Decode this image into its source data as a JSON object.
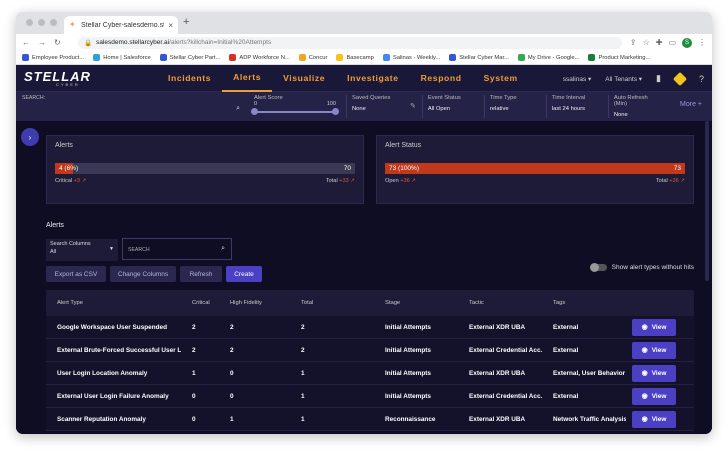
{
  "browser": {
    "tab_title": "Stellar Cyber-salesdemo.stella",
    "new_tab": "+",
    "url_host": "salesdemo.stellarcyber.ai",
    "url_path": "/alerts?killchain=Initial%20Attempts",
    "avatar": "S",
    "bookmarks": [
      {
        "label": "Employee Product...",
        "color": "#3557d6"
      },
      {
        "label": "Home | Salesforce",
        "color": "#2f9fe0"
      },
      {
        "label": "Stellar Cyber Part...",
        "color": "#3557d6"
      },
      {
        "label": "ADP Workforce N...",
        "color": "#d93025"
      },
      {
        "label": "Concur",
        "color": "#f2a81d"
      },
      {
        "label": "Basecamp",
        "color": "#f7c21b"
      },
      {
        "label": "Salinas - Weekly...",
        "color": "#4285f4"
      },
      {
        "label": "Stellar Cyber Mar...",
        "color": "#3557d6"
      },
      {
        "label": "My Drive - Google...",
        "color": "#34a853"
      },
      {
        "label": "Product Marketing...",
        "color": "#188038"
      }
    ]
  },
  "app": {
    "logo_main": "STELLAR",
    "logo_sub": "CYBER",
    "nav": [
      "Incidents",
      "Alerts",
      "Visualize",
      "Investigate",
      "Respond",
      "System"
    ],
    "active_nav": "Alerts",
    "user": "ssalinas ▾",
    "tenant": "All Tenants ▾"
  },
  "filters": {
    "search_label": "SEARCH:",
    "score_label": "Alert Score",
    "score_min": "0",
    "score_max": "100",
    "groups": [
      {
        "label": "Saved Queries",
        "value": "None"
      },
      {
        "label": "Event Status",
        "value": "All Open"
      },
      {
        "label": "Time Type",
        "value": "relative"
      },
      {
        "label": "Time Interval",
        "value": "last 24 hours"
      },
      {
        "label": "Auto Refresh (Min)",
        "value": "None"
      }
    ],
    "more": "More +"
  },
  "cards": {
    "alerts": {
      "title": "Alerts",
      "bar_left": "4 (6%)",
      "bar_right": "70",
      "fill": 0.06,
      "left_label": "Critical",
      "left_delta": "+3 ↗",
      "right_label": "Total",
      "right_delta": "+33 ↗"
    },
    "status": {
      "title": "Alert Status",
      "bar_left": "73 (100%)",
      "bar_right": "73",
      "fill": 1.0,
      "left_label": "Open",
      "left_delta": "+36 ↗",
      "right_label": "Total",
      "right_delta": "+36 ↗"
    }
  },
  "alerts_section": {
    "title": "Alerts",
    "search_columns_label": "Search Columns",
    "search_columns_value": "All",
    "search_placeholder": "SEARCH",
    "buttons": {
      "export": "Export as CSV",
      "change": "Change Columns",
      "refresh": "Refresh",
      "create": "Create"
    },
    "show_hits": "Show alert types without hits"
  },
  "table": {
    "headers": [
      "Alert Type",
      "Critical",
      "High Fidelity",
      "Total",
      "Stage",
      "Tactic",
      "Tags",
      ""
    ],
    "view_label": "View",
    "rows": [
      [
        "Google Workspace User Suspended",
        "2",
        "2",
        "2",
        "Initial Attempts",
        "External XDR UBA",
        "External"
      ],
      [
        "External Brute-Forced Successful User L...",
        "2",
        "2",
        "2",
        "Initial Attempts",
        "External Credential Acc...",
        "External"
      ],
      [
        "User Login Location Anomaly",
        "1",
        "0",
        "1",
        "Initial Attempts",
        "External XDR UBA",
        "External, User Behavior ..."
      ],
      [
        "External User Login Failure Anomaly",
        "0",
        "0",
        "1",
        "Initial Attempts",
        "External Credential Acc...",
        "External"
      ],
      [
        "Scanner Reputation Anomaly",
        "0",
        "1",
        "1",
        "Reconnaissance",
        "External XDR UBA",
        "Network Traffic Analysis"
      ]
    ]
  }
}
